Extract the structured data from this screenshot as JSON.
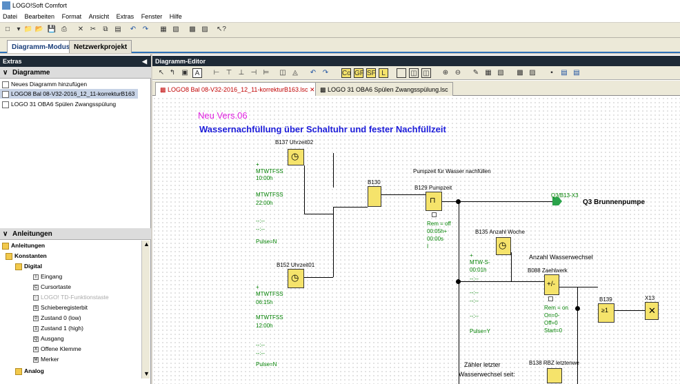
{
  "window": {
    "title": "LOGO!Soft Comfort"
  },
  "menu": [
    "Datei",
    "Bearbeiten",
    "Format",
    "Ansicht",
    "Extras",
    "Fenster",
    "Hilfe"
  ],
  "mode_tabs": [
    "Diagramm-Modus",
    "Netzwerkprojekt"
  ],
  "left": {
    "panel_title": "Extras",
    "diagrams_header": "Diagramme",
    "diagrams": [
      "Neues Diagramm hinzufügen",
      "LOGO8 Bal 08-V32-2016_12_11-korrekturB163",
      "LOGO 31 OBA6 Spülen  Zwangsspülung"
    ],
    "instructions_header": "Anleitungen",
    "tree": [
      "Anleitungen",
      "Konstanten",
      "Digital",
      "Eingang",
      "Cursortaste",
      "LOGO! TD-Funktionstaste",
      "Schieberegisterbit",
      "Zustand 0 (low)",
      "Zustand 1 (high)",
      "Ausgang",
      "Offene Klemme",
      "Merker",
      "Analog"
    ]
  },
  "editor": {
    "title": "Diagramm-Editor",
    "tabs": [
      "LOGO8 Bal 08-V32-2016_12_11-korrekturB163.lsc",
      "LOGO 31 OBA6 Spülen  Zwangsspülung.lsc"
    ]
  },
  "diagram": {
    "heading1": "Neu Vers.06",
    "heading2": "Wassernachfüllung über Schaltuhr und fester Nachfüllzeit",
    "labels": {
      "b137": "B137 Uhrzeit02",
      "b137_p1": "+",
      "b137_p2": "MTWTFSS",
      "b137_p3": "10:00h",
      "b137_p4": "MTWTFSS",
      "b137_p5": "22:00h",
      "b137_p6": "--:--",
      "b137_p7": "--:--",
      "b137_p8": "Pulse=N",
      "b130": "B130",
      "pump_desc": "Pumpzeit für Wasser nachfüllen",
      "b129": "B129 Pumpzeit",
      "b129_p1": "Rem = off",
      "b129_p2": "00:05h+",
      "b129_p3": "00:00s",
      "b129_p4": "I",
      "q3_id": "Q3/B13-X3",
      "q3_name": "Q3 Brunnenpumpe",
      "b152": "B152 Uhrzeit01",
      "b152_p1": "+",
      "b152_p2": "MTWTFSS",
      "b152_p3": "06:15h",
      "b152_p4": "MTWTFSS",
      "b152_p5": "12:00h",
      "b152_p6": "--:--",
      "b152_p7": "--:--",
      "b152_p8": "Pulse=N",
      "b135": "B135 Anzahl Woche",
      "wechsel": "Anzahl Wasserwechsel",
      "b135_p1": "+",
      "b135_p2": "MTW-S-",
      "b135_p3": "00:01h",
      "b135_p4": "--:--",
      "b135_p5": "--:--",
      "b135_p6": "--:--",
      "b135_p7": "--:--",
      "b135_p8": "Pulse=Y",
      "b088": "B088 Zaehlwerk",
      "b088_p1": "Rem = on",
      "b088_p2": "On=0-",
      "b088_p3": "Off=0",
      "b088_p4": "Start=0",
      "b139": "B139",
      "x13": "X13",
      "zaehler1": "Zähler letzter",
      "zaehler2": "Wasserwechsel seit:",
      "b138": "B138 RBZ letztenwe"
    }
  }
}
